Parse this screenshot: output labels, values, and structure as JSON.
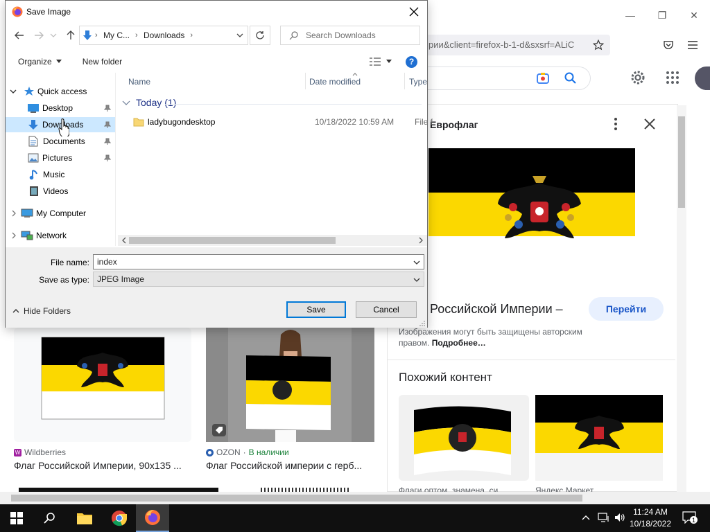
{
  "browser": {
    "url": "рии&client=firefox-b-1-d&sxsrf=ALiC",
    "window_controls": {
      "minimize": "—",
      "maximize": "❐",
      "close": "✕"
    }
  },
  "panel": {
    "title": "Еврофлаг",
    "heading": "Российской Империи –",
    "goto_label": "Перейти",
    "notice": "Изображения могут быть защищены авторским правом.",
    "notice_link": "Подробнее…",
    "similar_label": "Похожий контент",
    "sim1_source": "Флаги оптом, знамена, си",
    "sim2_source": "Яндекс Маркет"
  },
  "results": [
    {
      "source": "Wildberries",
      "title": "Флаг Российской Империи, 90х135 ..."
    },
    {
      "source": "OZON",
      "availability": "В наличии",
      "title": "Флаг Российской империи с герб..."
    }
  ],
  "dialog": {
    "title": "Save Image",
    "breadcrumb": [
      "My C...",
      "Downloads"
    ],
    "search_placeholder": "Search Downloads",
    "organize": "Organize",
    "new_folder": "New folder",
    "help": "?",
    "nav": {
      "quick_access": "Quick access",
      "desktop": "Desktop",
      "downloads": "Downloads",
      "documents": "Documents",
      "pictures": "Pictures",
      "music": "Music",
      "videos": "Videos",
      "my_computer": "My Computer",
      "network": "Network"
    },
    "columns": {
      "name": "Name",
      "date": "Date modified",
      "type": "Type"
    },
    "group": "Today (1)",
    "file": {
      "name": "ladybugondesktop",
      "date": "10/18/2022 10:59 AM",
      "type": "File f"
    },
    "file_name_label": "File name:",
    "file_name_value": "index",
    "save_type_label": "Save as type:",
    "save_type_value": "JPEG Image",
    "hide_folders": "Hide Folders",
    "save": "Save",
    "cancel": "Cancel"
  },
  "taskbar": {
    "time": "11:24 AM",
    "date": "10/18/2022",
    "notifications": "1"
  },
  "colors": {
    "flag_black": "#000000",
    "flag_yellow": "#fbd800",
    "flag_white": "#ffffff",
    "selected": "#cce8ff",
    "link_blue": "#1a56c8"
  }
}
